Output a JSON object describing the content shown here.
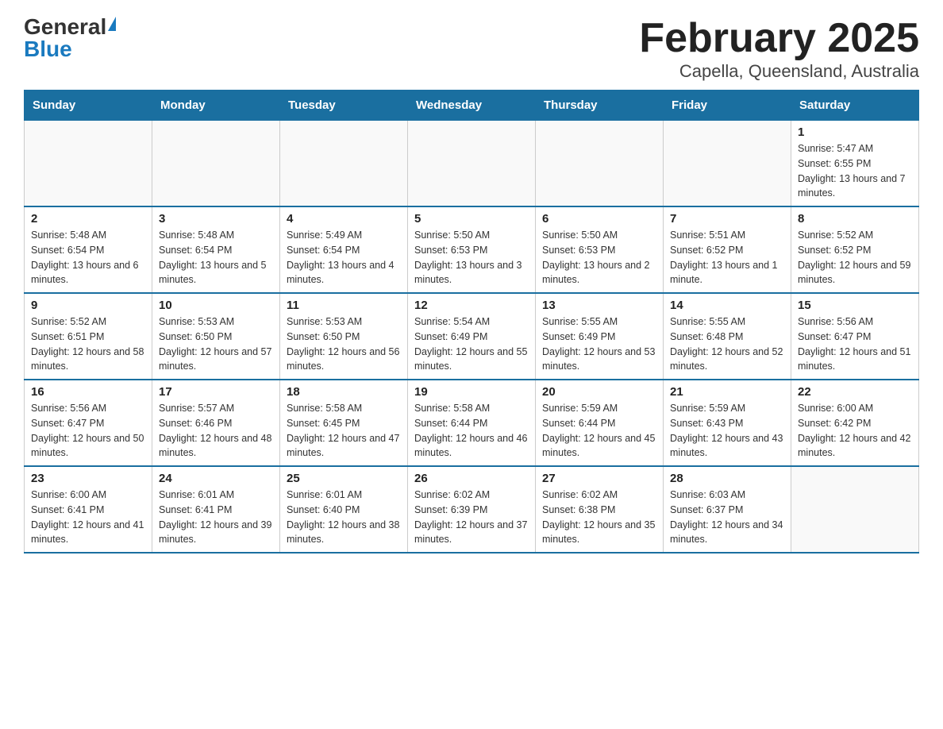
{
  "logo": {
    "general": "General",
    "blue": "Blue"
  },
  "title": "February 2025",
  "subtitle": "Capella, Queensland, Australia",
  "weekdays": [
    "Sunday",
    "Monday",
    "Tuesday",
    "Wednesday",
    "Thursday",
    "Friday",
    "Saturday"
  ],
  "weeks": [
    [
      {
        "day": "",
        "info": ""
      },
      {
        "day": "",
        "info": ""
      },
      {
        "day": "",
        "info": ""
      },
      {
        "day": "",
        "info": ""
      },
      {
        "day": "",
        "info": ""
      },
      {
        "day": "",
        "info": ""
      },
      {
        "day": "1",
        "info": "Sunrise: 5:47 AM\nSunset: 6:55 PM\nDaylight: 13 hours and 7 minutes."
      }
    ],
    [
      {
        "day": "2",
        "info": "Sunrise: 5:48 AM\nSunset: 6:54 PM\nDaylight: 13 hours and 6 minutes."
      },
      {
        "day": "3",
        "info": "Sunrise: 5:48 AM\nSunset: 6:54 PM\nDaylight: 13 hours and 5 minutes."
      },
      {
        "day": "4",
        "info": "Sunrise: 5:49 AM\nSunset: 6:54 PM\nDaylight: 13 hours and 4 minutes."
      },
      {
        "day": "5",
        "info": "Sunrise: 5:50 AM\nSunset: 6:53 PM\nDaylight: 13 hours and 3 minutes."
      },
      {
        "day": "6",
        "info": "Sunrise: 5:50 AM\nSunset: 6:53 PM\nDaylight: 13 hours and 2 minutes."
      },
      {
        "day": "7",
        "info": "Sunrise: 5:51 AM\nSunset: 6:52 PM\nDaylight: 13 hours and 1 minute."
      },
      {
        "day": "8",
        "info": "Sunrise: 5:52 AM\nSunset: 6:52 PM\nDaylight: 12 hours and 59 minutes."
      }
    ],
    [
      {
        "day": "9",
        "info": "Sunrise: 5:52 AM\nSunset: 6:51 PM\nDaylight: 12 hours and 58 minutes."
      },
      {
        "day": "10",
        "info": "Sunrise: 5:53 AM\nSunset: 6:50 PM\nDaylight: 12 hours and 57 minutes."
      },
      {
        "day": "11",
        "info": "Sunrise: 5:53 AM\nSunset: 6:50 PM\nDaylight: 12 hours and 56 minutes."
      },
      {
        "day": "12",
        "info": "Sunrise: 5:54 AM\nSunset: 6:49 PM\nDaylight: 12 hours and 55 minutes."
      },
      {
        "day": "13",
        "info": "Sunrise: 5:55 AM\nSunset: 6:49 PM\nDaylight: 12 hours and 53 minutes."
      },
      {
        "day": "14",
        "info": "Sunrise: 5:55 AM\nSunset: 6:48 PM\nDaylight: 12 hours and 52 minutes."
      },
      {
        "day": "15",
        "info": "Sunrise: 5:56 AM\nSunset: 6:47 PM\nDaylight: 12 hours and 51 minutes."
      }
    ],
    [
      {
        "day": "16",
        "info": "Sunrise: 5:56 AM\nSunset: 6:47 PM\nDaylight: 12 hours and 50 minutes."
      },
      {
        "day": "17",
        "info": "Sunrise: 5:57 AM\nSunset: 6:46 PM\nDaylight: 12 hours and 48 minutes."
      },
      {
        "day": "18",
        "info": "Sunrise: 5:58 AM\nSunset: 6:45 PM\nDaylight: 12 hours and 47 minutes."
      },
      {
        "day": "19",
        "info": "Sunrise: 5:58 AM\nSunset: 6:44 PM\nDaylight: 12 hours and 46 minutes."
      },
      {
        "day": "20",
        "info": "Sunrise: 5:59 AM\nSunset: 6:44 PM\nDaylight: 12 hours and 45 minutes."
      },
      {
        "day": "21",
        "info": "Sunrise: 5:59 AM\nSunset: 6:43 PM\nDaylight: 12 hours and 43 minutes."
      },
      {
        "day": "22",
        "info": "Sunrise: 6:00 AM\nSunset: 6:42 PM\nDaylight: 12 hours and 42 minutes."
      }
    ],
    [
      {
        "day": "23",
        "info": "Sunrise: 6:00 AM\nSunset: 6:41 PM\nDaylight: 12 hours and 41 minutes."
      },
      {
        "day": "24",
        "info": "Sunrise: 6:01 AM\nSunset: 6:41 PM\nDaylight: 12 hours and 39 minutes."
      },
      {
        "day": "25",
        "info": "Sunrise: 6:01 AM\nSunset: 6:40 PM\nDaylight: 12 hours and 38 minutes."
      },
      {
        "day": "26",
        "info": "Sunrise: 6:02 AM\nSunset: 6:39 PM\nDaylight: 12 hours and 37 minutes."
      },
      {
        "day": "27",
        "info": "Sunrise: 6:02 AM\nSunset: 6:38 PM\nDaylight: 12 hours and 35 minutes."
      },
      {
        "day": "28",
        "info": "Sunrise: 6:03 AM\nSunset: 6:37 PM\nDaylight: 12 hours and 34 minutes."
      },
      {
        "day": "",
        "info": ""
      }
    ]
  ]
}
